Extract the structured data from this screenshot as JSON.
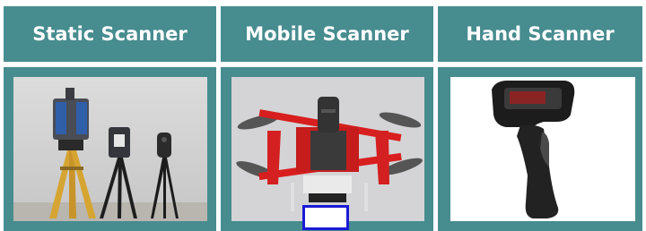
{
  "columns": [
    {
      "title": "Static Scanner",
      "image_icon": "tripod-laser-scanner-icon"
    },
    {
      "title": "Mobile Scanner",
      "image_icon": "drone-scanner-icon"
    },
    {
      "title": "Hand Scanner",
      "image_icon": "handheld-barcode-scanner-icon"
    }
  ],
  "colors": {
    "header_bg": "#478c8f",
    "cell_bg": "#478c8f",
    "header_text": "#ffffff",
    "marker_border": "#1a1ad6"
  }
}
